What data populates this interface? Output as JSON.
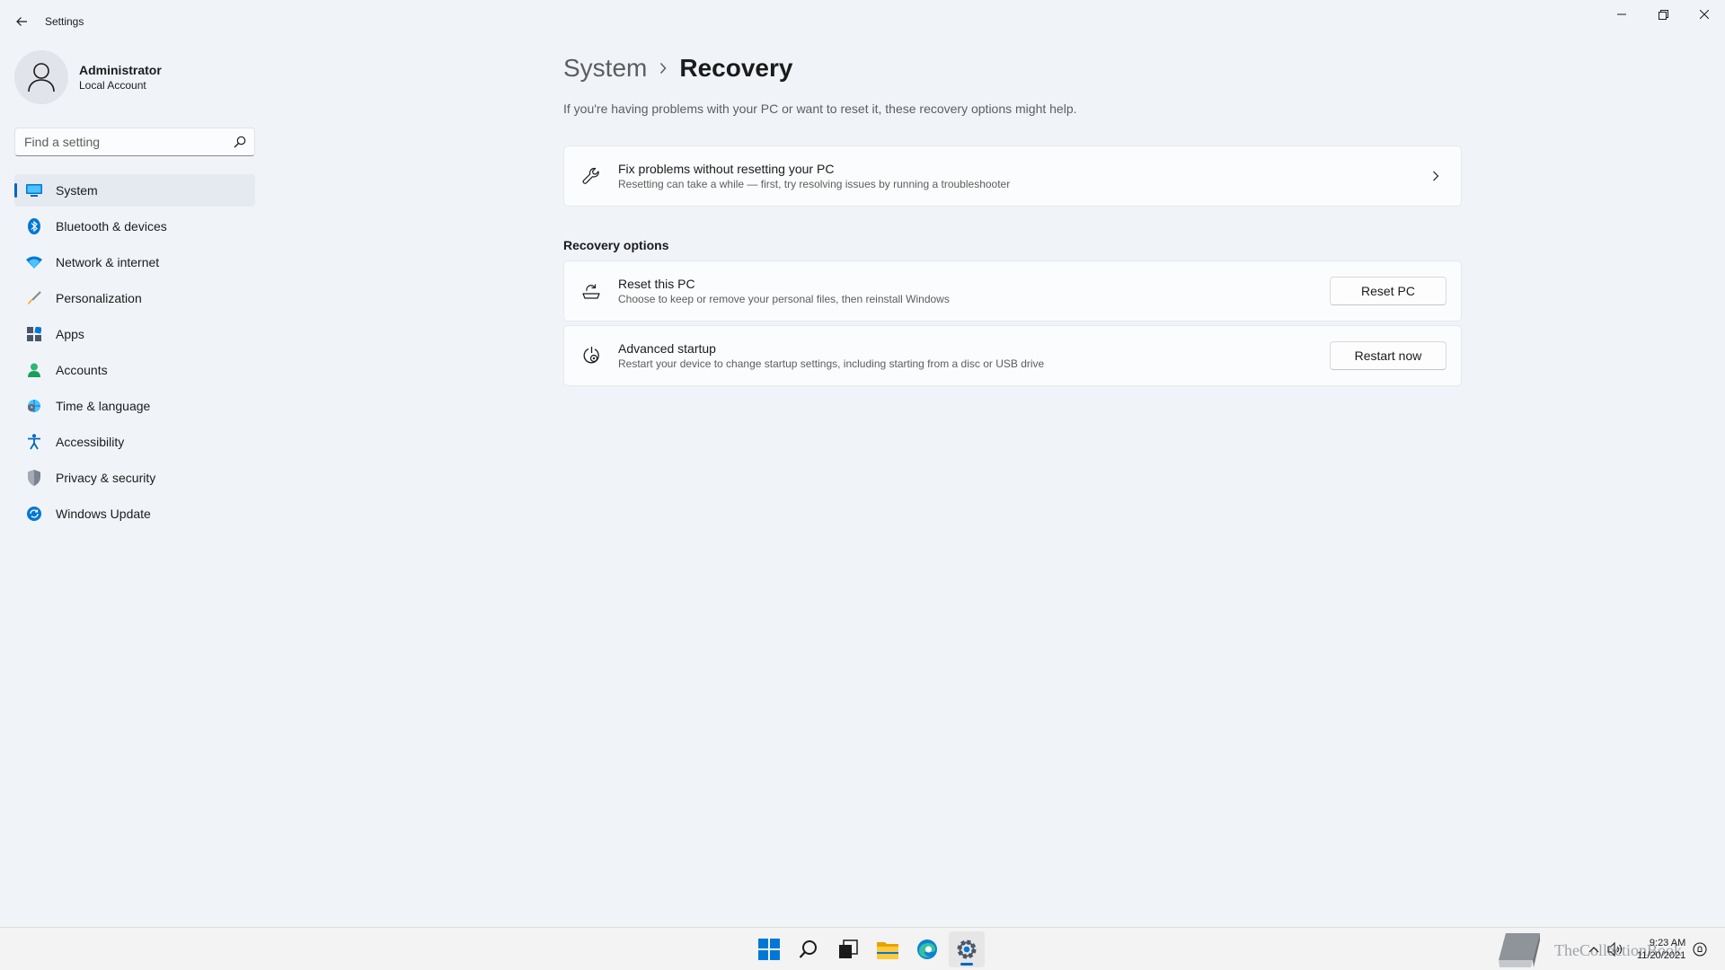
{
  "window": {
    "title": "Settings"
  },
  "profile": {
    "name": "Administrator",
    "account_type": "Local Account"
  },
  "search": {
    "placeholder": "Find a setting",
    "value": ""
  },
  "sidebar": {
    "items": [
      {
        "label": "System",
        "icon": "system-icon",
        "active": true
      },
      {
        "label": "Bluetooth & devices",
        "icon": "bluetooth-icon"
      },
      {
        "label": "Network & internet",
        "icon": "wifi-icon"
      },
      {
        "label": "Personalization",
        "icon": "brush-icon"
      },
      {
        "label": "Apps",
        "icon": "apps-icon"
      },
      {
        "label": "Accounts",
        "icon": "person-icon"
      },
      {
        "label": "Time & language",
        "icon": "globe-clock-icon"
      },
      {
        "label": "Accessibility",
        "icon": "accessibility-icon"
      },
      {
        "label": "Privacy & security",
        "icon": "shield-icon"
      },
      {
        "label": "Windows Update",
        "icon": "sync-icon"
      }
    ]
  },
  "breadcrumb": {
    "parent": "System",
    "current": "Recovery"
  },
  "main": {
    "description": "If you're having problems with your PC or want to reset it, these recovery options might help.",
    "fix_card": {
      "title": "Fix problems without resetting your PC",
      "subtitle": "Resetting can take a while — first, try resolving issues by running a troubleshooter",
      "icon": "wrench-icon"
    },
    "section_title": "Recovery options",
    "options": [
      {
        "title": "Reset this PC",
        "subtitle": "Choose to keep or remove your personal files, then reinstall Windows",
        "button": "Reset PC",
        "icon": "reset-pc-icon"
      },
      {
        "title": "Advanced startup",
        "subtitle": "Restart your device to change startup settings, including starting from a disc or USB drive",
        "button": "Restart now",
        "icon": "advanced-startup-icon"
      }
    ]
  },
  "taskbar": {
    "apps": [
      "start-icon",
      "search-icon",
      "task-view-icon",
      "file-explorer-icon",
      "edge-icon",
      "settings-icon"
    ],
    "watermark": "TheCollectionBook",
    "time": "9:23 AM",
    "date": "11/20/2021"
  },
  "colors": {
    "accent": "#0067c0",
    "background": "#f0f4f9",
    "card": "#fbfcfd"
  }
}
